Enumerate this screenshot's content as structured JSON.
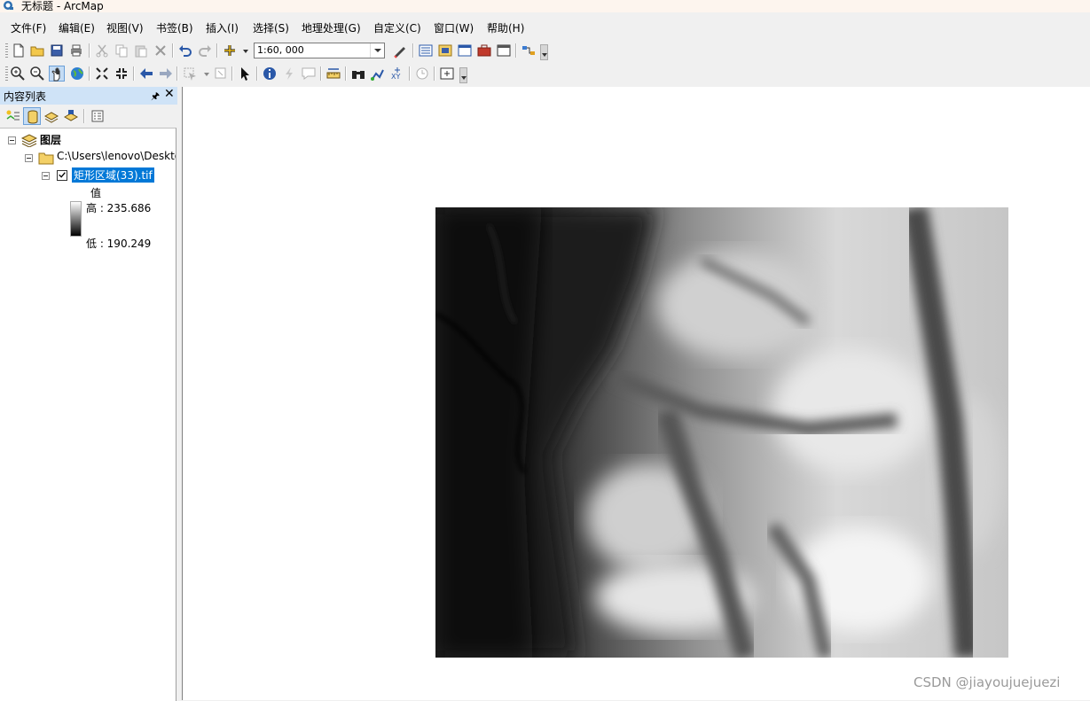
{
  "window": {
    "title": "无标题 - ArcMap"
  },
  "menu": [
    "文件(F)",
    "编辑(E)",
    "视图(V)",
    "书签(B)",
    "插入(I)",
    "选择(S)",
    "地理处理(G)",
    "自定义(C)",
    "窗口(W)",
    "帮助(H)"
  ],
  "toolbar": {
    "scale_value": "1:60, 000"
  },
  "toc": {
    "title": "内容列表",
    "root_label": "图层",
    "folder_label": "C:\\Users\\lenovo\\Deskto",
    "layer_label": "矩形区域(33).tif",
    "legend_field": "值",
    "legend_high": "高 : 235.686",
    "legend_low": "低 : 190.249"
  },
  "watermark": "CSDN @jiayoujuejuezi"
}
